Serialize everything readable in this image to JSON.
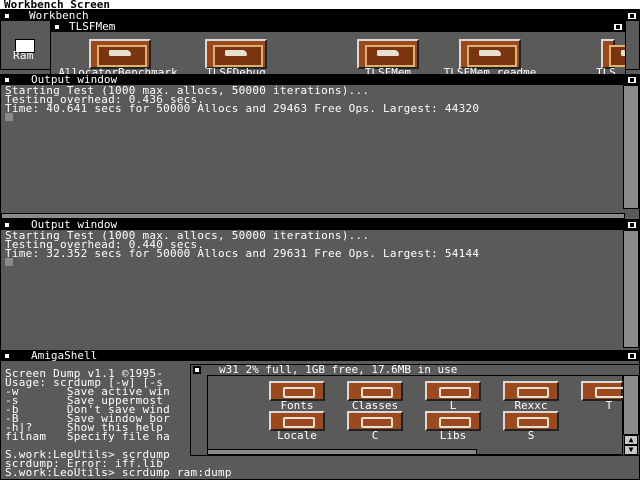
{
  "screen": {
    "title": "Workbench Screen"
  },
  "workbench": {
    "title": "Workbench",
    "ram_label": "Ram"
  },
  "tlsf": {
    "title": "TLSFMem",
    "icons": [
      {
        "label": "AllocatorBenchmark",
        "icon": "tool-icon"
      },
      {
        "label": "TLSFDebug",
        "icon": "tool-icon"
      },
      {
        "label": "TLSFMem",
        "icon": "tool-icon"
      },
      {
        "label": "TLSFMem.readme",
        "icon": "tool-icon"
      },
      {
        "label": "TLS",
        "icon": "tool-icon"
      }
    ]
  },
  "output1": {
    "title": "Output window",
    "lines": [
      "Starting Test (1000 max. allocs, 50000 iterations)...",
      "Testing overhead: 0.436 secs.",
      "Time: 40.641 secs for 50000 Allocs and 29463 Free Ops. Largest: 44320"
    ]
  },
  "output2": {
    "title": "Output window",
    "lines": [
      "Starting Test (1000 max. allocs, 50000 iterations)...",
      "Testing overhead: 0.440 secs.",
      "Time: 32.352 secs for 50000 Allocs and 29631 Free Ops. Largest: 54144"
    ]
  },
  "shell": {
    "title": "AmigaShell",
    "lines": [
      "Screen Dump v1.1 ©1995-",
      "Usage: scrdump [-w] [-s",
      "-w       Save active win",
      "-s       Save uppermost",
      "-b       Don't save wind",
      "-B       Save window bor",
      "-h|?     Show this help",
      "filnam   Specify file na",
      "",
      "S.work:LeoUtils> scrdump",
      "scrdump: Error: iff.lib",
      "S.work:LeoUtils> scrdump ram:dump"
    ]
  },
  "w31": {
    "title": "w31   2% full, 1GB free, 17.6MB in use",
    "drawers": [
      {
        "label": "Fonts"
      },
      {
        "label": "Classes"
      },
      {
        "label": "L"
      },
      {
        "label": "Rexxc"
      },
      {
        "label": "T"
      },
      {
        "label": "Locale"
      },
      {
        "label": "C"
      },
      {
        "label": "Libs"
      },
      {
        "label": "S"
      }
    ]
  },
  "colors": {
    "desktop": "#5a5a5a",
    "title_bar": "#000000",
    "text": "#ffffff",
    "icon": "#9a4a1e"
  }
}
